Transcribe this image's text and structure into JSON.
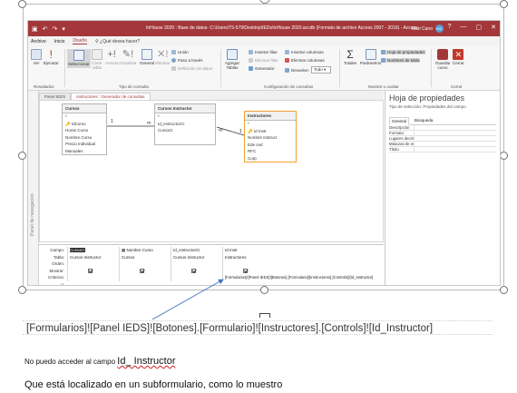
{
  "access": {
    "title": "InHouse 2020 : Base de datos- C:\\Users\\T5-579\\Desktop\\IEDs\\InHouse 2020.accdb (Formato de archivo Access 2007 - 2016) - Access",
    "user_name": "Mari Cano",
    "user_initials": "MC",
    "qat_icons": [
      "save-icon",
      "undo-icon",
      "redo-icon",
      "qat-dropdown-icon"
    ],
    "window_buttons": [
      "?",
      "—",
      "▢",
      "✕"
    ],
    "ribbon_tabs": [
      "Archivo",
      "Inicio",
      "Diseño"
    ],
    "active_tab": "Diseño",
    "tell_me": "¿Qué desea hacer?",
    "groups": {
      "resultados": {
        "label": "Resultados",
        "buttons": [
          "Ver",
          "Ejecutar"
        ]
      },
      "tipo_consulta": {
        "label": "Tipo de consulta",
        "buttons": [
          "Seleccionar",
          "Crear tabla",
          "Anexar",
          "Actualizar",
          "General",
          "Eliminar"
        ],
        "small": [
          "Unión",
          "Paso a través",
          "Definición de datos"
        ]
      },
      "configuracion": {
        "label": "Configuración de consultas",
        "big": "Agregar Tablas",
        "small": [
          "Insertar filas",
          "Eliminar filas",
          "Generador",
          "Insertar columnas",
          "Eliminar columnas",
          "Devuelve:"
        ],
        "devuelve_value": "Todo"
      },
      "mostrar": {
        "label": "Mostrar u ocultar",
        "buttons": [
          "Totales",
          "Parámetros"
        ],
        "small": [
          "Hoja de propiedades",
          "Nombres de tabla"
        ]
      },
      "cerrar": {
        "label": "Cerrar",
        "buttons": [
          "Guardar como",
          "Cerrar"
        ]
      }
    },
    "nav_pane_label": "Panel de navegación",
    "doc_tabs": [
      "Panel IEDS",
      "Instructores : Generador de consultas"
    ],
    "tables": [
      {
        "name": "Cursos",
        "fields": [
          "*",
          "IdCurso",
          "Horas Curso",
          "Nombre Curso",
          "Precio Individual",
          "Manuales"
        ]
      },
      {
        "name": "Cursos Instructor",
        "fields": [
          "*",
          "Id_InstructorCI",
          "CursoCI"
        ]
      },
      {
        "name": "Instructores",
        "fields": [
          "*",
          "Id Instr",
          "Nombre Instruct",
          "Ede ced",
          "RFC",
          "Curp"
        ]
      }
    ],
    "relation_labels": [
      "1",
      "∞",
      "∞",
      "1"
    ],
    "grid_rows": [
      "Campo:",
      "Tabla:",
      "Orden:",
      "Mostrar:",
      "Criterios:",
      "o:"
    ],
    "grid_columns": [
      {
        "campo": "CursoCI",
        "tabla": "Cursos Instructor",
        "mostrar": true
      },
      {
        "campo": "Nombre Curso",
        "tabla": "Cursos",
        "mostrar": true
      },
      {
        "campo": "Id_InstructorCI",
        "tabla": "Cursos Instructor",
        "mostrar": true
      },
      {
        "campo": "Id Instr",
        "tabla": "Instructores",
        "mostrar": true
      }
    ],
    "criteria": "[Formularios]![Panel IEDS]![Botones].[Formulario]![Instructores].[Controls]![Id_Instructor]",
    "properties": {
      "title": "Hoja de propiedades",
      "subtitle": "Tipo de selección: Propiedades del campo",
      "tabs": [
        "General",
        "Búsqueda"
      ],
      "rows": [
        "Descripción",
        "Formato",
        "Lugares decimales",
        "Máscara de entrada",
        "Título"
      ]
    }
  },
  "document": {
    "expression": "[Formularios]![Panel IEDS]![Botones].[Formulario]![Instructores].[Controls]![Id_Instructor]",
    "line2_prefix": "No puedo acceder al campo ",
    "line2_field": "Id_ Instructor",
    "line3": "Que está localizado en un subformulario, como lo muestro"
  },
  "colors": {
    "access_red": "#a4373a",
    "selected_table": "#f0a030",
    "arrow": "#4472c4"
  }
}
